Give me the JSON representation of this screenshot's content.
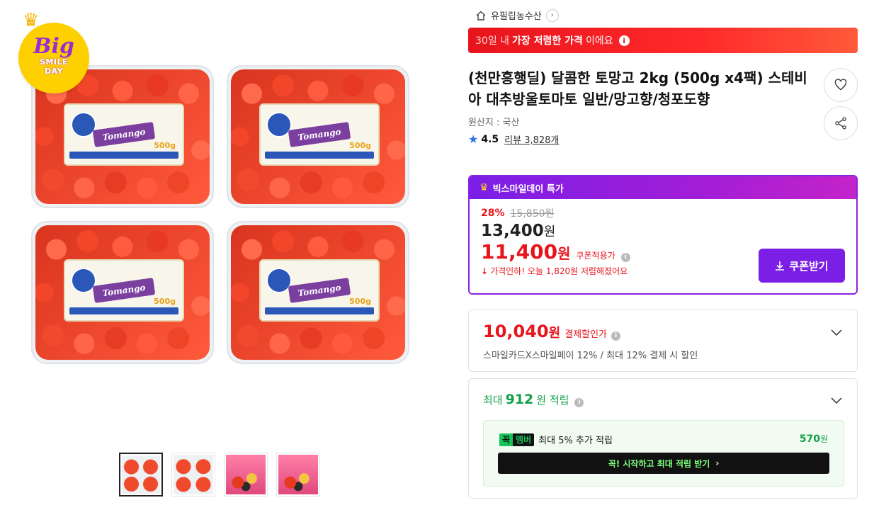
{
  "gallery": {
    "event_badge": {
      "big": "Big",
      "line1": "SMILE",
      "line2": "DAY"
    },
    "pack_label": {
      "brand": "Tomango",
      "weight": "500g"
    },
    "thumbnails": [
      {
        "kind": "packs",
        "active": true
      },
      {
        "kind": "packs",
        "active": false
      },
      {
        "kind": "pink",
        "active": false
      },
      {
        "kind": "pink",
        "active": false
      }
    ]
  },
  "shop": {
    "name": "유필립농수산"
  },
  "lowest_banner": {
    "prefix": "30일 내 ",
    "highlight": "가장 저렴한 가격",
    "suffix": "이에요"
  },
  "product": {
    "title": "(천만흥행딜) 달콤한 토망고 2kg (500g x4팩) 스테비아 대추방울토마토 일반/망고향/청포도향",
    "origin": "원산지 : 국산",
    "rating": "4.5",
    "reviews": "리뷰 3,828개"
  },
  "deal": {
    "header": "빅스마일데이 특가",
    "discount_rate": "28%",
    "original_price": "15,850원",
    "sale_price": "13,400",
    "sale_unit": "원",
    "coupon_price": "11,400",
    "coupon_unit": "원",
    "coupon_label": "쿠폰적용가",
    "price_drop": "가격인하! 오늘 1,820원 저렴해졌어요",
    "coupon_button": "쿠폰받기"
  },
  "payment": {
    "amount": "10,040",
    "unit": "원",
    "label": "결제할인가",
    "desc": "스마일카드X스마일페이 12% / 최대 12% 결제 시 할인"
  },
  "reward": {
    "prefix": "최대",
    "amount": "912",
    "suffix": "원 적립",
    "member_tag_a": "꼭",
    "member_tag_b": "멤버",
    "member_text": "최대 5% 추가 적립",
    "member_amount": "570",
    "member_unit": "원",
    "cta": "꼭! 시작하고 최대 적립 받기"
  },
  "colors": {
    "accent_red": "#e8141c",
    "purple": "#7b1ee6",
    "green": "#12a04a",
    "star_blue": "#2c6ee8"
  }
}
